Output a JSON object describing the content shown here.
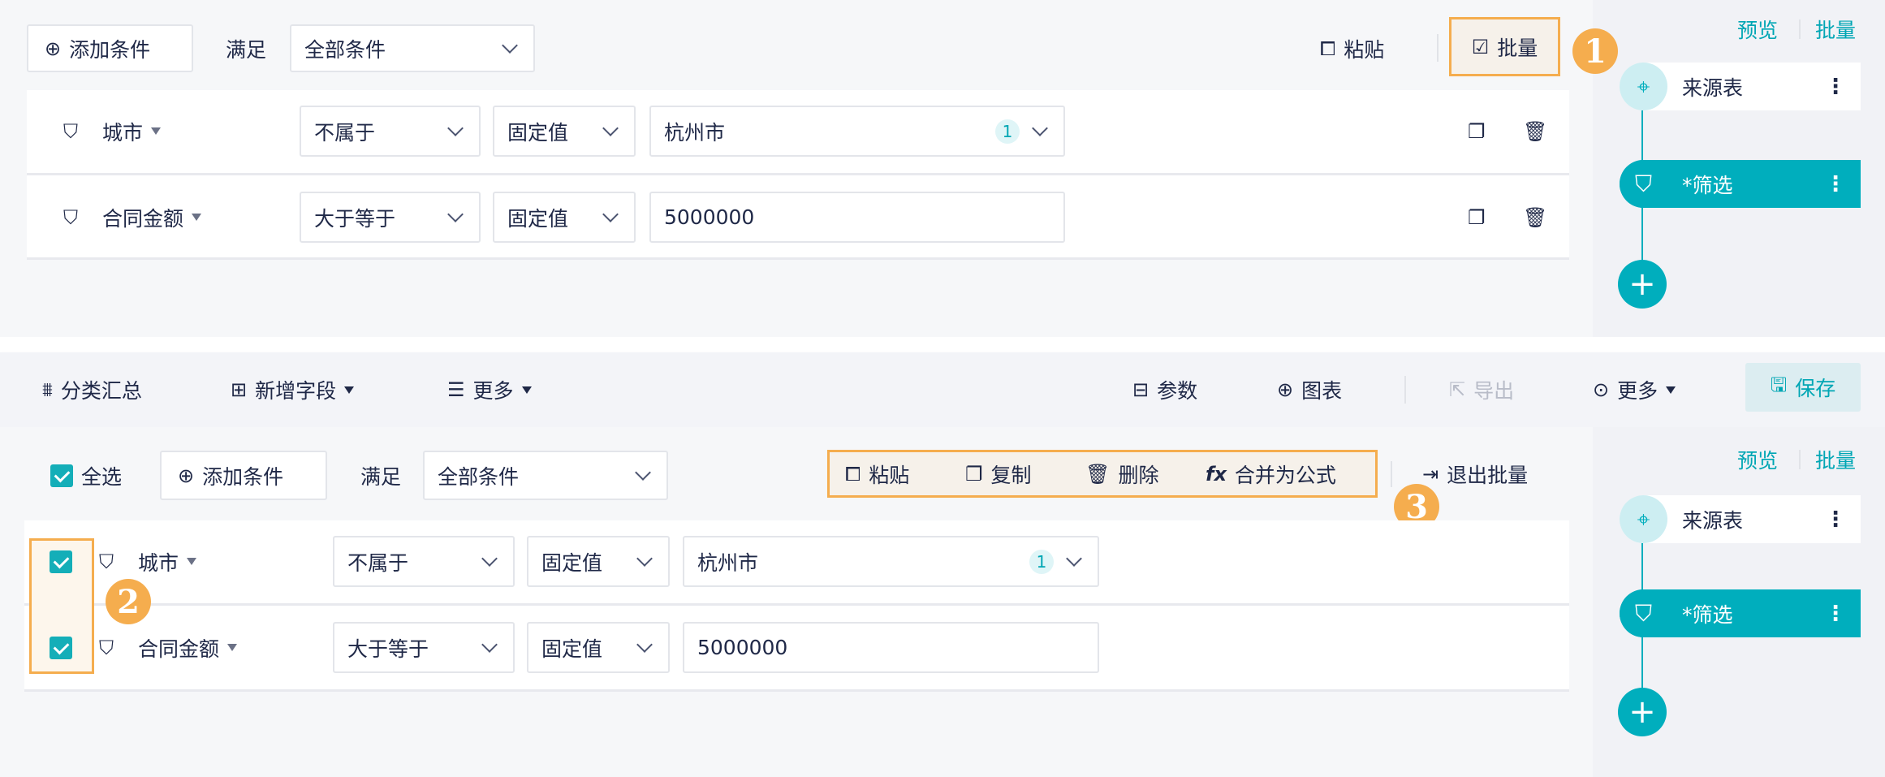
{
  "colors": {
    "accent": "#00aebd",
    "highlight": "#f5ad4e",
    "text": "#1f2847"
  },
  "top": {
    "add_condition": "添加条件",
    "match_label": "满足",
    "match_value": "全部条件",
    "paste": "粘贴",
    "batch": "批量",
    "badge": "1",
    "rows": [
      {
        "field": "城市",
        "operator": "不属于",
        "value_type": "固定值",
        "value": "杭州市",
        "count": "1"
      },
      {
        "field": "合同金额",
        "operator": "大于等于",
        "value_type": "固定值",
        "value": "5000000"
      }
    ]
  },
  "sidebar": {
    "preview": "预览",
    "batch": "批量",
    "nodes": [
      {
        "label": "来源表",
        "icon": "target-icon"
      },
      {
        "label": "*筛选",
        "icon": "filter-icon"
      }
    ]
  },
  "toolbar": {
    "group": "分类汇总",
    "add_field": "新增字段",
    "more_left": "更多",
    "params": "参数",
    "chart": "图表",
    "export": "导出",
    "more_right": "更多",
    "save": "保存"
  },
  "bottom": {
    "select_all": "全选",
    "add_condition": "添加条件",
    "match_label": "满足",
    "match_value": "全部条件",
    "batch_actions": {
      "paste": "粘贴",
      "copy": "复制",
      "delete": "删除",
      "merge": "合并为公式"
    },
    "exit_batch": "退出批量",
    "badge2": "2",
    "badge3": "3",
    "rows": [
      {
        "field": "城市",
        "operator": "不属于",
        "value_type": "固定值",
        "value": "杭州市",
        "count": "1",
        "checked": true
      },
      {
        "field": "合同金额",
        "operator": "大于等于",
        "value_type": "固定值",
        "value": "5000000",
        "checked": true
      }
    ]
  }
}
